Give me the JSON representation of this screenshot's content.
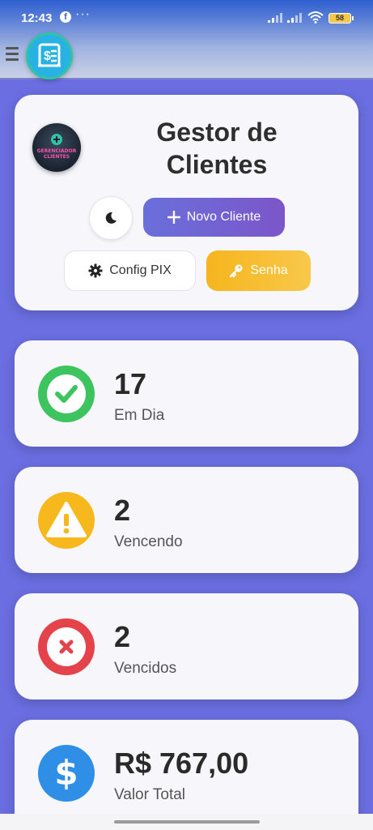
{
  "status_bar": {
    "time": "12:43",
    "facebook_glyph": "f",
    "dots": "···",
    "battery": "58"
  },
  "header": {
    "title": "Gestor de Clientes",
    "avatar_caption": "GERENCIADOR CLIENTES",
    "new_client_label": "Novo Cliente",
    "pix_label": "Config PIX",
    "password_label": "Senha"
  },
  "stats": [
    {
      "value": "17",
      "label": "Em Dia",
      "color": "#3dc45e",
      "icon": "check-circle-icon"
    },
    {
      "value": "2",
      "label": "Vencendo",
      "color": "#f7b81d",
      "icon": "warning-triangle-icon"
    },
    {
      "value": "2",
      "label": "Vencidos",
      "color": "#e5434c",
      "icon": "close-circle-icon"
    },
    {
      "value": "R$ 767,00",
      "label": "Valor Total",
      "color": "#2f8fe6",
      "icon": "dollar-icon"
    }
  ],
  "colors": {
    "background": "#6a6ee0",
    "primary": "#7163d4",
    "warning": "#f7b81d"
  }
}
